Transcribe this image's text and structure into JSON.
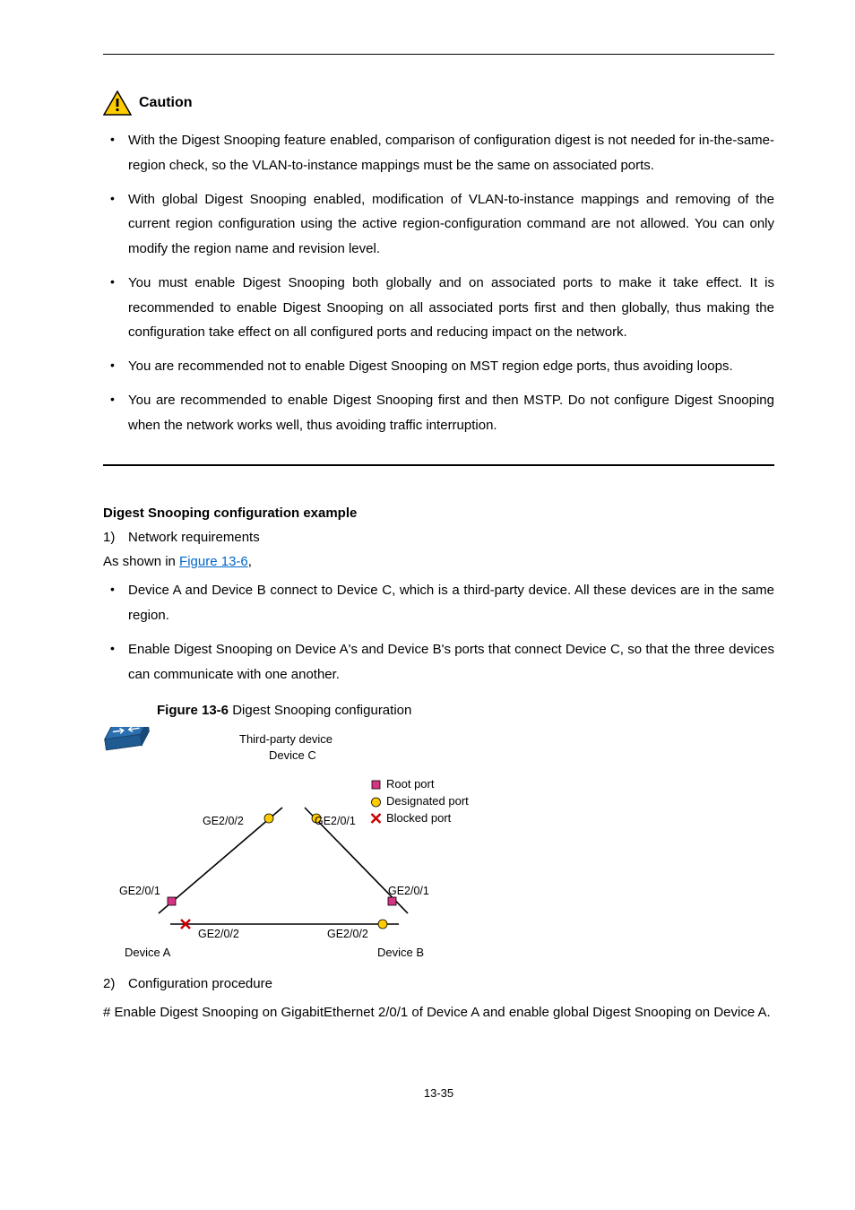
{
  "caution": {
    "label": "Caution",
    "items": [
      "With the Digest Snooping feature enabled, comparison of configuration digest is not needed for in-the-same-region check, so the VLAN-to-instance mappings must be the same on associated ports.",
      "With global Digest Snooping enabled, modification of VLAN-to-instance mappings and removing of the current region configuration using the active region-configuration command are not allowed. You can only modify the region name and revision level.",
      "You must enable Digest Snooping both globally and on associated ports to make it take effect. It is recommended to enable Digest Snooping on all associated ports first and then globally, thus making the configuration take effect on all configured ports and reducing impact on the network.",
      "You are recommended not to enable Digest Snooping on MST region edge ports, thus avoiding loops.",
      "You are recommended to enable Digest Snooping first and then MSTP. Do not configure Digest Snooping when the network works well, thus avoiding traffic interruption."
    ]
  },
  "example_heading": "Digest Snooping configuration example",
  "netreq": {
    "num": "1)",
    "label": "Network requirements"
  },
  "as_shown_prefix": "As shown in ",
  "figure_link": "Figure 13-6",
  "as_shown_suffix": ",",
  "req_items": [
    "Device A and Device B connect to Device C, which is a third-party device. All these devices are in the same region.",
    "Enable Digest Snooping on Device A's and Device B's ports that connect Device C, so that the three devices can communicate with one another."
  ],
  "figure_caption_prefix": "Figure 13-6 ",
  "figure_caption_rest": "Digest Snooping configuration",
  "diagram": {
    "third_party": "Third-party device",
    "device_c": "Device C",
    "device_a": "Device A",
    "device_b": "Device B",
    "ge201": "GE2/0/1",
    "ge202": "GE2/0/2",
    "legend_root": "Root port",
    "legend_desig": "Designated port",
    "legend_block": "Blocked port"
  },
  "cfgproc": {
    "num": "2)",
    "label": "Configuration procedure"
  },
  "cfgproc_body": "# Enable Digest Snooping on GigabitEthernet 2/0/1 of Device A and enable global Digest Snooping on Device A.",
  "page_number": "13-35"
}
